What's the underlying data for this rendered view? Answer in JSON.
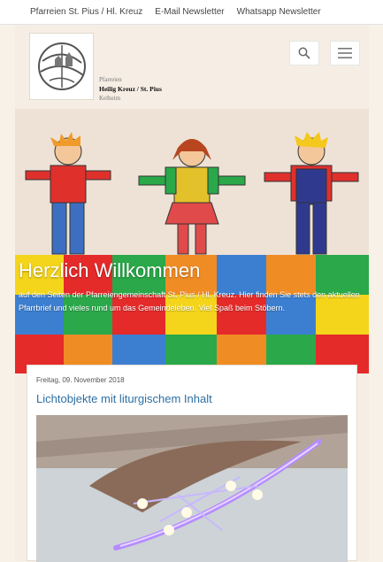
{
  "topnav": {
    "link1": "Pfarreien St. Pius / Hl. Kreuz",
    "link2": "E-Mail Newsletter",
    "link3": "Whatsapp Newsletter"
  },
  "brand": {
    "line1": "Pfarreien",
    "line2": "Heilig Kreuz / St. Pius",
    "line3": "Kelheim"
  },
  "icons": {
    "search": "search-icon",
    "menu": "hamburger-menu-icon",
    "logo": "parish-logo"
  },
  "hero": {
    "title": "Herzlich Willkommen",
    "text": "auf den Seiten der Pfarreiengemeinschaft St. Pius / Hl. Kreuz. Hier finden Sie stets den aktuellen Pfarrbrief und vieles rund um das Gemeindeleben. Viel Spaß beim Stöbern."
  },
  "article": {
    "date": "Freitag, 09. November 2018",
    "title": "Lichtobjekte mit liturgischem Inhalt"
  },
  "colors": {
    "link": "#2d6fa3",
    "background": "#f6eee4",
    "tile_red": "#e52a2a",
    "tile_yellow": "#f4d51c",
    "tile_green": "#2aa84a",
    "tile_blue": "#3c7fd1",
    "tile_orange": "#f08c24"
  }
}
